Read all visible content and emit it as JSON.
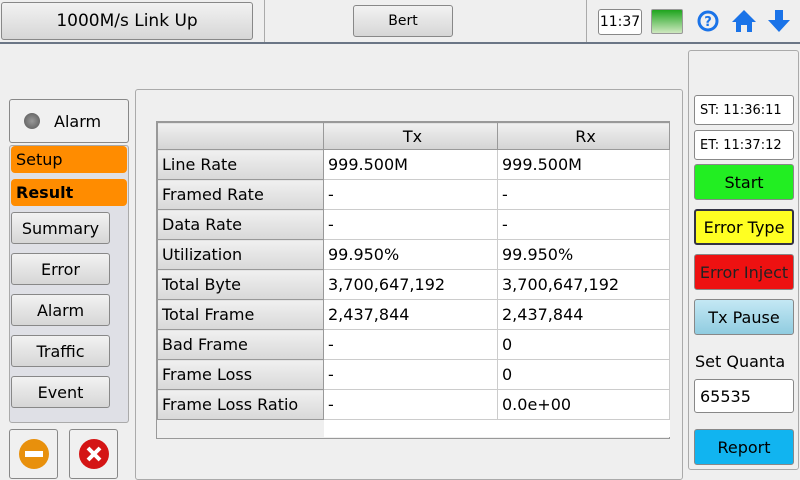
{
  "header": {
    "link_status": "1000M/s Link Up",
    "mode": "Bert",
    "clock": "11:37"
  },
  "sidebar": {
    "alarm_label": "Alarm",
    "tabs": [
      "Setup",
      "Result"
    ],
    "nav": [
      "Summary",
      "Error",
      "Alarm",
      "Traffic",
      "Event"
    ]
  },
  "table": {
    "headers": [
      "",
      "Tx",
      "Rx"
    ],
    "rows": [
      [
        "Line Rate",
        "999.500M",
        "999.500M"
      ],
      [
        "Framed Rate",
        "-",
        "-"
      ],
      [
        "Data Rate",
        "-",
        "-"
      ],
      [
        "Utilization",
        "99.950%",
        "99.950%"
      ],
      [
        "Total Byte",
        "3,700,647,192",
        "3,700,647,192"
      ],
      [
        "Total Frame",
        "2,437,844",
        "2,437,844"
      ],
      [
        "Bad Frame",
        "-",
        "0"
      ],
      [
        "Frame Loss",
        "-",
        "0"
      ],
      [
        "Frame Loss Ratio",
        "-",
        "0.0e+00"
      ]
    ]
  },
  "right": {
    "st": "ST:  11:36:11",
    "et": "ET:  11:37:12",
    "start": "Start",
    "error_type": "Error Type",
    "error_inject": "Error Inject",
    "tx_pause": "Tx Pause",
    "set_quanta_label": "Set Quanta",
    "quanta_value": "65535",
    "report": "Report"
  },
  "colors": {
    "start": "#22ee22",
    "error_type": "#ffff22",
    "error_inject": "#ee1111",
    "tx_pause": "#a8d8e8",
    "report": "#11b4f0",
    "tab": "#ff8c00"
  }
}
